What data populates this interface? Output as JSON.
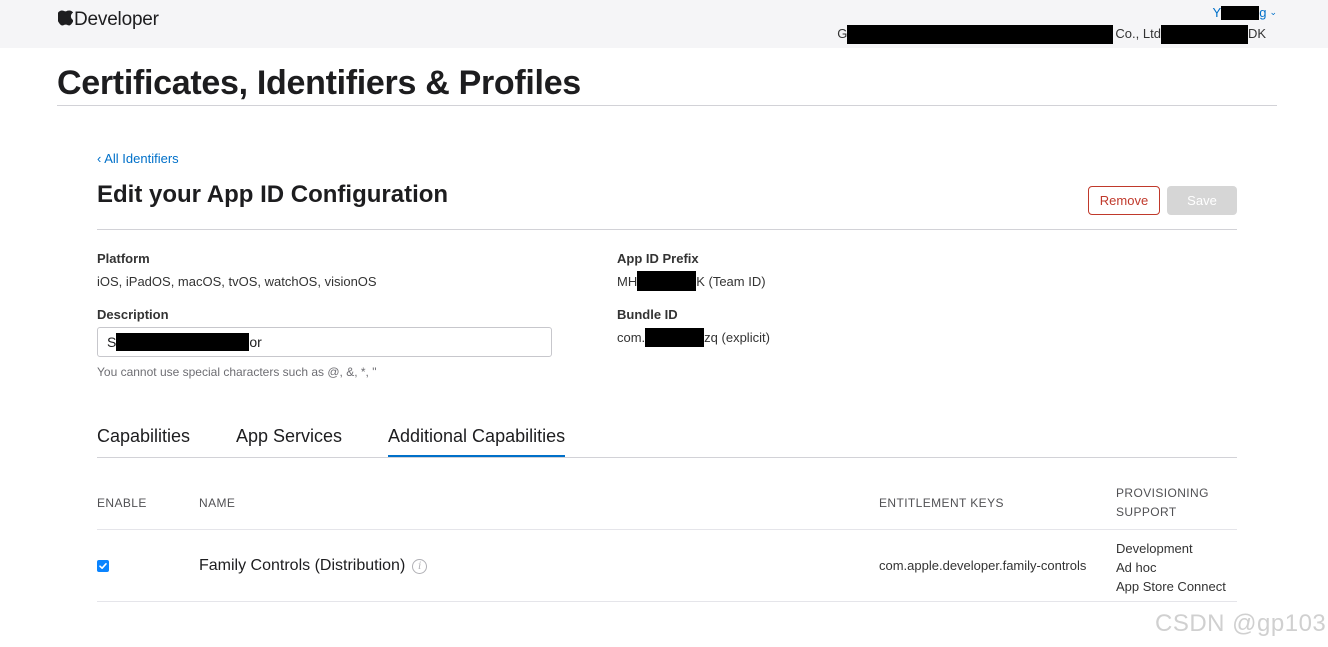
{
  "header": {
    "brand_label": "Developer",
    "account_name_start": "Y",
    "account_name_end": "g",
    "team_start": "G",
    "team_middle": "Co., Ltd",
    "team_end": "DK"
  },
  "page_title": "Certificates, Identifiers & Profiles",
  "back_link": "‹ All Identifiers",
  "section_title": "Edit your App ID Configuration",
  "buttons": {
    "remove": "Remove",
    "save": "Save"
  },
  "fields": {
    "platform_label": "Platform",
    "platform_value": "iOS, iPadOS, macOS, tvOS, watchOS, visionOS",
    "description_label": "Description",
    "description_start": "S",
    "description_end": "or",
    "description_hint": "You cannot use special characters such as @, &, *, \"",
    "prefix_label": "App ID Prefix",
    "prefix_start": "MH",
    "prefix_end": "K (Team ID)",
    "bundle_label": "Bundle ID",
    "bundle_start": "com.",
    "bundle_end": "zq (explicit)"
  },
  "tabs": [
    {
      "label": "Capabilities"
    },
    {
      "label": "App Services"
    },
    {
      "label": "Additional Capabilities"
    }
  ],
  "table": {
    "headers": {
      "enable": "ENABLE",
      "name": "NAME",
      "entitlement": "ENTITLEMENT KEYS",
      "provisioning_1": "PROVISIONING",
      "provisioning_2": "SUPPORT"
    },
    "rows": [
      {
        "enabled": true,
        "name": "Family Controls (Distribution)",
        "entitlement": "com.apple.developer.family-controls",
        "provisioning": [
          "Development",
          "Ad hoc",
          "App Store Connect"
        ]
      }
    ]
  },
  "watermark": "CSDN @gp103",
  "colors": {
    "accent": "#0070c9",
    "remove": "#c0392b",
    "save_disabled": "#d6d6d6",
    "topbar": "#f5f5f7"
  }
}
